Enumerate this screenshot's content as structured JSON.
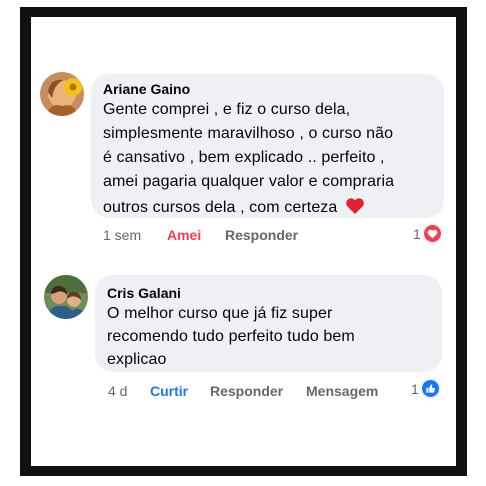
{
  "comments": [
    {
      "author": "Ariane Gaino",
      "lines": [
        "Gente comprei , e fiz o curso dela,",
        "simplesmente maravilhoso , o curso não",
        "é cansativo , bem explicado .. perfeito ,",
        "amei pagaria qualquer valor e compraria",
        "outros cursos dela , com certeza"
      ],
      "emoji": "heart-emoji",
      "time": "1 sem",
      "reaction_action": "Amei",
      "reply": "Responder",
      "reaction_count": "1",
      "reaction_icon": "heart-icon",
      "accent": "#f33e58"
    },
    {
      "author": "Cris Galani",
      "lines": [
        "O melhor curso que já fiz super",
        "recomendo tudo perfeito  tudo bem",
        "explicao"
      ],
      "time": "4 d",
      "reaction_action": "Curtir",
      "reply": "Responder",
      "message": "Mensagem",
      "reaction_count": "1",
      "reaction_icon": "like-icon",
      "accent": "#1877f2"
    }
  ],
  "colors": {
    "bubble": "#eef0f3",
    "frame": "#111111"
  }
}
